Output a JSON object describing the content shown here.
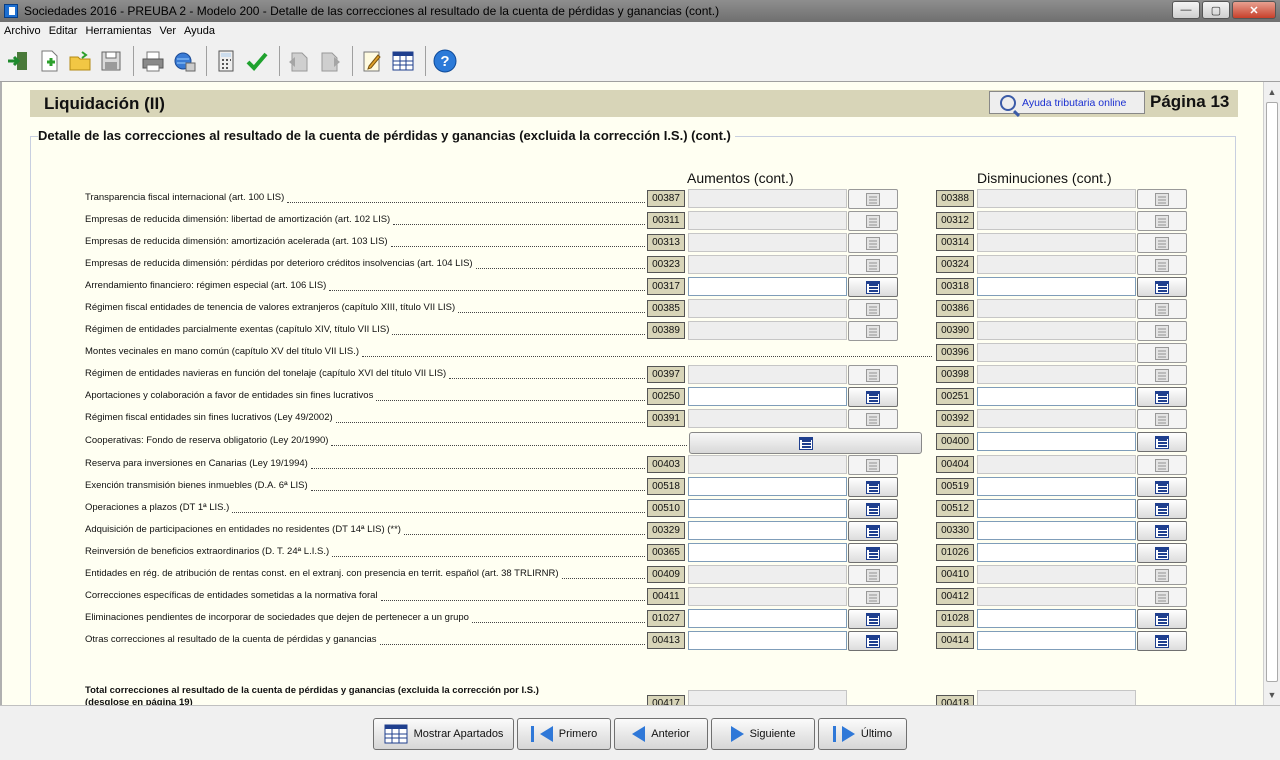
{
  "window": {
    "title": "Sociedades 2016 - PREUBA 2 - Modelo 200 - Detalle de las correcciones al resultado de la cuenta de pérdidas y ganancias (cont.)",
    "min": "—",
    "max": "▢",
    "close": "✕"
  },
  "menu": [
    "Archivo",
    "Editar",
    "Herramientas",
    "Ver",
    "Ayuda"
  ],
  "header": {
    "title": "Liquidación (II)",
    "help_label": "Ayuda tributaria online",
    "page_label": "Página 13"
  },
  "subtitle": "Detalle de las correcciones al resultado de la cuenta de pérdidas y ganancias (excluida la corrección I.S.) (cont.)",
  "columns": {
    "increases": "Aumentos (cont.)",
    "decreases": "Disminuciones (cont.)"
  },
  "rows": [
    {
      "label": "Transparencia fiscal internacional (art. 100 LIS)",
      "c1": "00387",
      "c2": "00388"
    },
    {
      "label": "Empresas de reducida dimensión: libertad de amortización (art. 102 LIS)",
      "c1": "00311",
      "c2": "00312"
    },
    {
      "label": "Empresas de reducida dimensión: amortización acelerada (art. 103 LIS)",
      "c1": "00313",
      "c2": "00314"
    },
    {
      "label": "Empresas de reducida dimensión: pérdidas por deterioro créditos insolvencias (art. 104 LIS)",
      "c1": "00323",
      "c2": "00324"
    },
    {
      "label": "Arrendamiento financiero: régimen especial (art. 106 LIS)",
      "c1": "00317",
      "c2": "00318"
    },
    {
      "label": "Régimen fiscal entidades de tenencia de valores extranjeros (capítulo XIII, título VII LIS)",
      "c1": "00385",
      "c2": "00386"
    },
    {
      "label": "Régimen de entidades parcialmente exentas (capítulo XIV, título VII LIS)",
      "c1": "00389",
      "c2": "00390"
    },
    {
      "label": "Montes vecinales en mano común (capítulo XV del título VII LIS.)",
      "c1": "",
      "c2": "00396"
    },
    {
      "label": "Régimen de entidades navieras en función del tonelaje (capítulo XVI del título VII LIS)",
      "c1": "00397",
      "c2": "00398"
    },
    {
      "label": "Aportaciones y colaboración a favor de entidades sin fines lucrativos",
      "c1": "00250",
      "c2": "00251"
    },
    {
      "label": "Régimen fiscal entidades sin fines lucrativos (Ley 49/2002)",
      "c1": "00391",
      "c2": "00392"
    },
    {
      "label": "Cooperativas: Fondo de reserva obligatorio (Ley 20/1990)",
      "c1": "",
      "c2": "00400"
    },
    {
      "label": "Reserva para inversiones en Canarias (Ley 19/1994)",
      "c1": "00403",
      "c2": "00404"
    },
    {
      "label": "Exención transmisión bienes inmuebles (D.A. 6ª LIS)",
      "c1": "00518",
      "c2": "00519"
    },
    {
      "label": "Operaciones a plazos (DT 1ª LIS.)",
      "c1": "00510",
      "c2": "00512"
    },
    {
      "label": "Adquisición de participaciones en entidades no residentes (DT 14ª LIS) (**)",
      "c1": "00329",
      "c2": "00330"
    },
    {
      "label": "Reinversión de beneficios extraordinarios (D. T. 24ª L.I.S.)",
      "c1": "00365",
      "c2": "01026"
    },
    {
      "label": "Entidades en rég. de atribución de rentas const. en el extranj. con presencia en territ. español (art. 38 TRLIRNR)",
      "c1": "00409",
      "c2": "00410"
    },
    {
      "label": "Correcciones específicas de entidades sometidas a la normativa foral",
      "c1": "00411",
      "c2": "00412"
    },
    {
      "label": "Eliminaciones pendientes de incorporar de sociedades que dejen de pertenecer a un grupo",
      "c1": "01027",
      "c2": "01028"
    },
    {
      "label": "Otras correcciones al resultado de la cuenta de pérdidas y ganancias",
      "c1": "00413",
      "c2": "00414"
    }
  ],
  "total": {
    "line1": "Total correcciones al resultado de la cuenta de pérdidas y ganancias (excluida la corrección por I.S.)",
    "line2": "(desglose en página 19)",
    "c1": "00417",
    "c2": "00418"
  },
  "nav": {
    "show": "Mostrar Apartados",
    "first": "Primero",
    "prev": "Anterior",
    "next": "Siguiente",
    "last": "Último"
  }
}
